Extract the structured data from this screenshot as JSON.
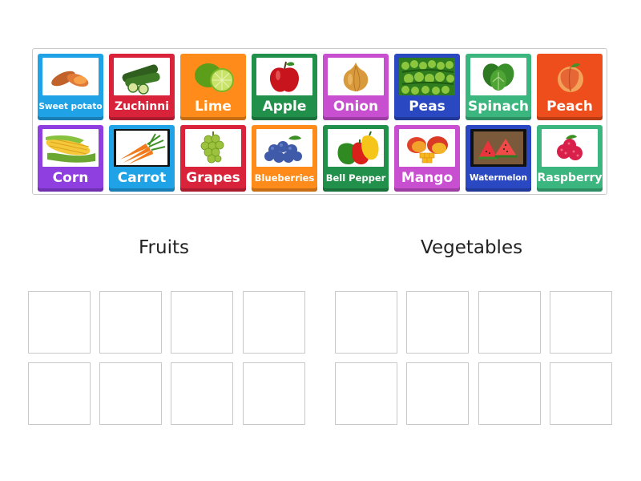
{
  "tiles": [
    {
      "label": "Sweet potato",
      "color": "#1fa2e6",
      "icon": "sweet-potato-icon"
    },
    {
      "label": "Zuchinni",
      "color": "#d9233a",
      "icon": "zucchini-icon"
    },
    {
      "label": "Lime",
      "color": "#ff8c1a",
      "icon": "lime-icon"
    },
    {
      "label": "Apple",
      "color": "#21904b",
      "icon": "apple-icon"
    },
    {
      "label": "Onion",
      "color": "#c94fd1",
      "icon": "onion-icon"
    },
    {
      "label": "Peas",
      "color": "#2a48c2",
      "icon": "peas-icon"
    },
    {
      "label": "Spinach",
      "color": "#3cb67f",
      "icon": "spinach-icon"
    },
    {
      "label": "Peach",
      "color": "#ee4d1c",
      "icon": "peach-icon"
    },
    {
      "label": "Corn",
      "color": "#8f3fe0",
      "icon": "corn-icon"
    },
    {
      "label": "Carrot",
      "color": "#1fa2e6",
      "icon": "carrot-icon"
    },
    {
      "label": "Grapes",
      "color": "#d9233a",
      "icon": "grapes-icon"
    },
    {
      "label": "Blueberries",
      "color": "#ff8c1a",
      "icon": "blueberries-icon"
    },
    {
      "label": "Bell Pepper",
      "color": "#21904b",
      "icon": "bell-pepper-icon"
    },
    {
      "label": "Mango",
      "color": "#c94fd1",
      "icon": "mango-icon"
    },
    {
      "label": "Watermelon",
      "color": "#2a48c2",
      "icon": "watermelon-icon"
    },
    {
      "label": "Raspberry",
      "color": "#3cb67f",
      "icon": "raspberry-icon"
    }
  ],
  "groups": {
    "fruits": {
      "title": "Fruits"
    },
    "vegetables": {
      "title": "Vegetables"
    }
  }
}
